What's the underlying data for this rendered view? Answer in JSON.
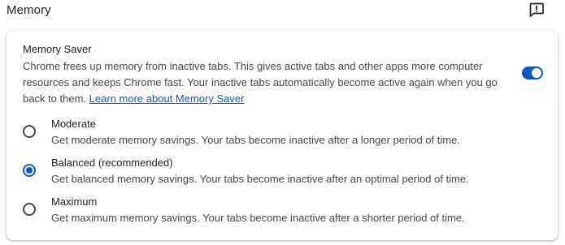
{
  "section": {
    "title": "Memory",
    "feedback_icon": "feedback-icon"
  },
  "memory_saver": {
    "title": "Memory Saver",
    "description": "Chrome frees up memory from inactive tabs. This gives active tabs and other apps more computer resources and keeps Chrome fast. Your inactive tabs automatically become active again when you go back to them.",
    "link_text": "Learn more about Memory Saver",
    "enabled": true,
    "accent_color": "#0b57d0"
  },
  "options": [
    {
      "label": "Moderate",
      "description": "Get moderate memory savings. Your tabs become inactive after a longer period of time.",
      "selected": false
    },
    {
      "label": "Balanced (recommended)",
      "description": "Get balanced memory savings. Your tabs become inactive after an optimal period of time.",
      "selected": true
    },
    {
      "label": "Maximum",
      "description": "Get maximum memory savings. Your tabs become inactive after a shorter period of time.",
      "selected": false
    }
  ]
}
